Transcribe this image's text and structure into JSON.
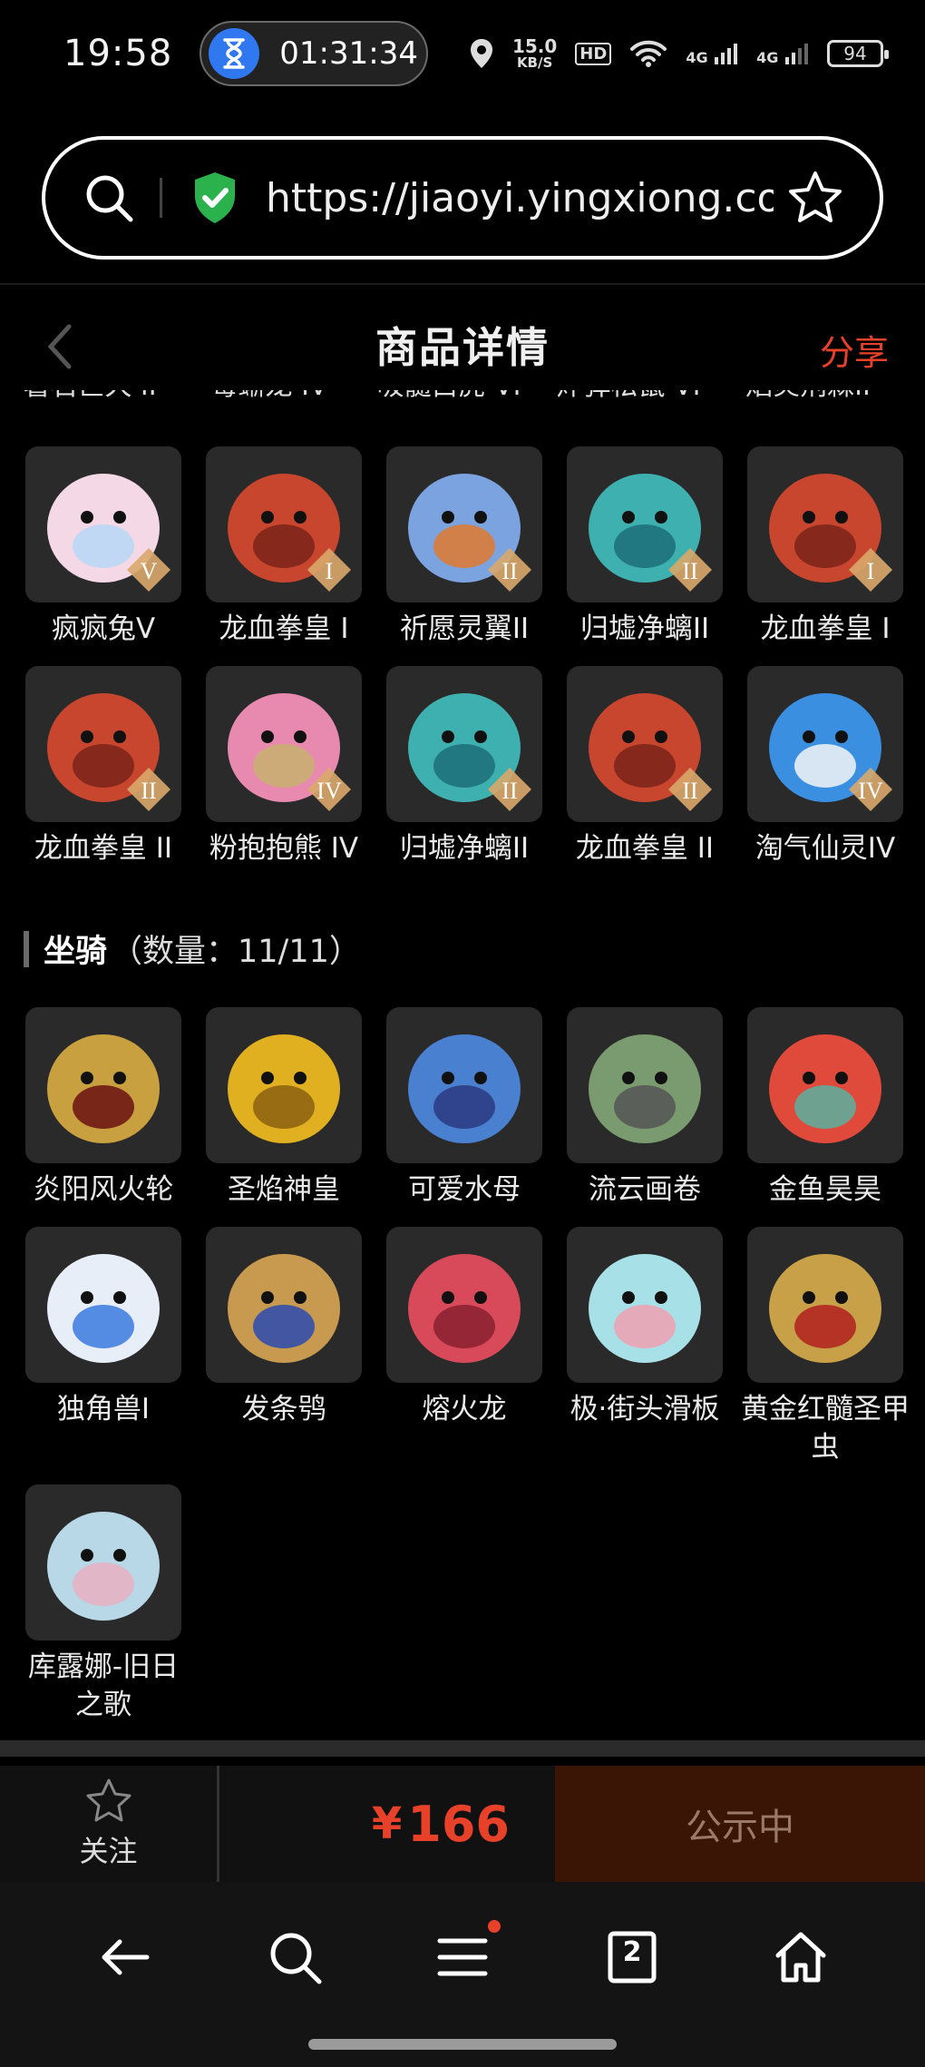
{
  "status_bar": {
    "time": "19:58",
    "timer": "01:31:34",
    "net_speed_value": "15.0",
    "net_speed_unit": "KB/S",
    "hd_label": "HD",
    "signal1": "4G",
    "signal2": "4G",
    "battery": "94"
  },
  "browser": {
    "url": "https://jiaoyi.yingxiong.co..."
  },
  "header": {
    "title": "商品详情",
    "share": "分享"
  },
  "cut_row": [
    "暑石巨犬 II",
    "毒蜥龙 IV",
    "吸髓白虎 VI",
    "炸弹松鼠 VI",
    "焰炎荆棘II"
  ],
  "pets": [
    {
      "label": "疯疯兔V",
      "color": "#f4d8e6",
      "accent": "#b6d8f4",
      "badge": "V"
    },
    {
      "label": "龙血拳皇 I",
      "color": "#c8452e",
      "accent": "#7a2318",
      "badge": "I"
    },
    {
      "label": "祈愿灵翼II",
      "color": "#7aa3e0",
      "accent": "#e07a2e",
      "badge": "II"
    },
    {
      "label": "归墟净螭II",
      "color": "#3fb0b0",
      "accent": "#1d6e78",
      "badge": "II"
    },
    {
      "label": "龙血拳皇 I",
      "color": "#c8452e",
      "accent": "#7a2318",
      "badge": "I"
    },
    {
      "label": "龙血拳皇 II",
      "color": "#c8452e",
      "accent": "#7a2318",
      "badge": "II"
    },
    {
      "label": "粉抱抱熊 IV",
      "color": "#e88ab0",
      "accent": "#c8b070",
      "badge": "IV"
    },
    {
      "label": "归墟净螭II",
      "color": "#3fb0b0",
      "accent": "#1d6e78",
      "badge": "II"
    },
    {
      "label": "龙血拳皇 II",
      "color": "#c8452e",
      "accent": "#7a2318",
      "badge": "II"
    },
    {
      "label": "淘气仙灵IV",
      "color": "#3a8fe0",
      "accent": "#f4f4f4",
      "badge": "IV"
    }
  ],
  "mount_section": {
    "title": "坐骑",
    "count": "（数量：11/11）"
  },
  "mounts": [
    {
      "label": "炎阳风火轮",
      "color": "#c8a040",
      "accent": "#6a1010"
    },
    {
      "label": "圣焰神皇",
      "color": "#e0b020",
      "accent": "#8a6010"
    },
    {
      "label": "可爱水母",
      "color": "#4a80d0",
      "accent": "#2a3a80"
    },
    {
      "label": "流云画卷",
      "color": "#7a9a70",
      "accent": "#555555"
    },
    {
      "label": "金鱼昊昊",
      "color": "#e04a3a",
      "accent": "#5ab0a0"
    },
    {
      "label": "独角兽I",
      "color": "#e8eef8",
      "accent": "#3a7ae0"
    },
    {
      "label": "发条鸮",
      "color": "#c89a50",
      "accent": "#2a4ab0"
    },
    {
      "label": "熔火龙",
      "color": "#d84a5a",
      "accent": "#8a2030"
    },
    {
      "label": "极·街头滑板",
      "color": "#a8e0e8",
      "accent": "#f0a0b0"
    },
    {
      "label": "黄金红髓圣甲虫",
      "color": "#c8a048",
      "accent": "#b02020"
    },
    {
      "label": "库露娜-旧日之歌",
      "color": "#b8d8e8",
      "accent": "#e8b0c0"
    }
  ],
  "bottom_bar": {
    "follow": "关注",
    "currency": "¥",
    "price": "166",
    "status": "公示中"
  },
  "browser_nav": {
    "tabs_count": "2"
  }
}
